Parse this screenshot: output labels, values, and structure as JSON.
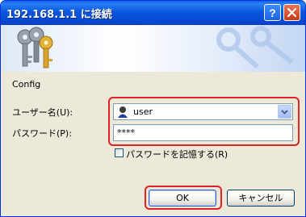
{
  "window": {
    "title": "192.168.1.1 に接続"
  },
  "titlebar": {
    "help_label": "?",
    "close_label": "×"
  },
  "dialog": {
    "realm": "Config",
    "username_label": "ユーザー名(U):",
    "username_value": "user",
    "password_label": "パスワード(P):",
    "password_value": "****",
    "remember_label": "パスワードを記憶する(R)",
    "remember_checked": false,
    "ok_label": "OK",
    "cancel_label": "キャンセル"
  },
  "colors": {
    "titlebar": "#0a58e0",
    "highlight": "#e0202a",
    "dialog_bg": "#ece9d8"
  }
}
